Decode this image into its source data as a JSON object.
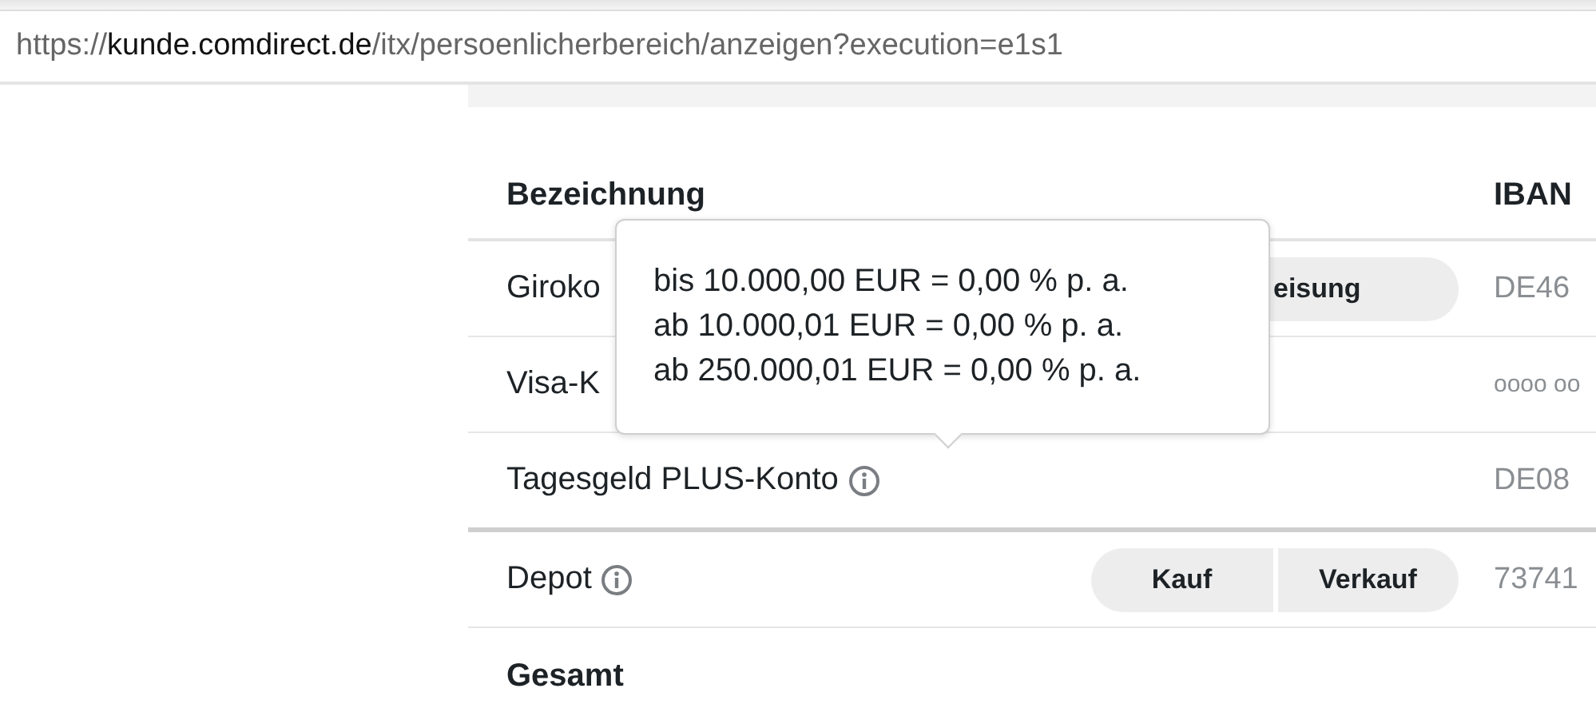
{
  "address_bar": {
    "scheme": "https://",
    "host": "kunde.comdirect.de",
    "path": "/itx/persoenlicherbereich/anzeigen?execution=e1s1"
  },
  "table": {
    "columns": [
      "Bezeichnung",
      "IBAN"
    ],
    "rows": [
      {
        "name": "Giroko",
        "info": false,
        "buttons": [
          "eisung"
        ],
        "iban": "DE46",
        "kind": "account"
      },
      {
        "name": "Visa-K",
        "info": false,
        "buttons": [],
        "iban": "oooo oo",
        "kind": "account"
      },
      {
        "name": "Tagesgeld PLUS-Konto",
        "info": true,
        "buttons": [],
        "iban": "DE08",
        "kind": "account"
      },
      {
        "name": "Depot",
        "info": true,
        "buttons": [
          "Kauf",
          "Verkauf"
        ],
        "iban": "73741",
        "kind": "depot"
      },
      {
        "name": "Gesamt",
        "info": false,
        "buttons": [],
        "iban": "",
        "kind": "total"
      }
    ]
  },
  "tooltip": {
    "lines": [
      "bis 10.000,00 EUR = 0,00 % p. a.",
      "ab 10.000,01 EUR = 0,00 % p. a.",
      "ab 250.000,01 EUR = 0,00 % p. a."
    ]
  }
}
